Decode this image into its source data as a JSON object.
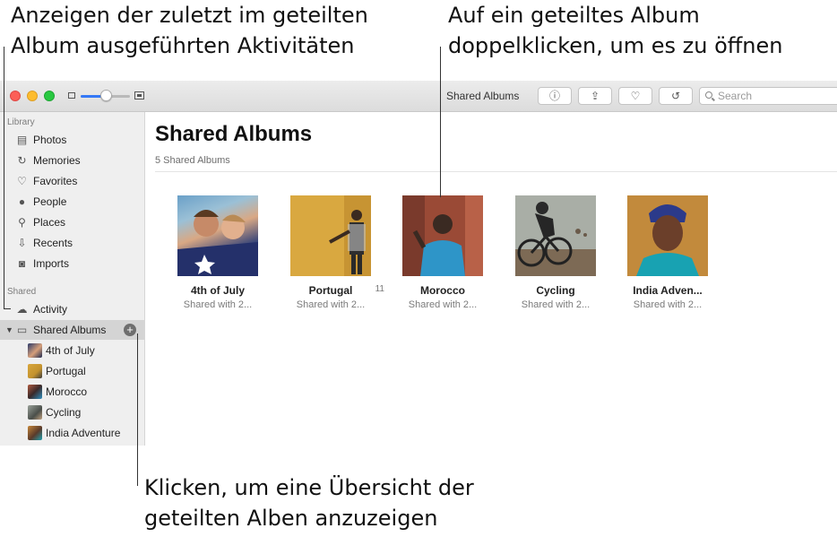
{
  "callouts": {
    "activity_line1": "Anzeigen der zuletzt im geteilten",
    "activity_line2": "Album ausgeführten Aktivitäten",
    "open_line1": "Auf ein geteiltes Album",
    "open_line2": "doppelklicken, um es zu öffnen",
    "overview_line1": "Klicken, um eine Übersicht der",
    "overview_line2": "geteilten Alben anzuzeigen"
  },
  "window": {
    "title": "Shared Albums",
    "search_placeholder": "Search",
    "zoom_fraction": 0.45
  },
  "toolbar": {
    "info_icon": "ⓘ",
    "share_icon": "⇪",
    "favorite_icon": "♡",
    "rotate_icon": "↺"
  },
  "sidebar": {
    "library_heading": "Library",
    "library_items": [
      {
        "label": "Photos",
        "icon": "photos-icon"
      },
      {
        "label": "Memories",
        "icon": "memories-icon"
      },
      {
        "label": "Favorites",
        "icon": "heart-icon"
      },
      {
        "label": "People",
        "icon": "person-icon"
      },
      {
        "label": "Places",
        "icon": "pin-icon"
      },
      {
        "label": "Recents",
        "icon": "recents-icon"
      },
      {
        "label": "Imports",
        "icon": "camera-icon"
      }
    ],
    "shared_heading": "Shared",
    "activity_label": "Activity",
    "shared_albums_label": "Shared Albums",
    "shared_albums": [
      {
        "label": "4th of July"
      },
      {
        "label": "Portugal"
      },
      {
        "label": "Morocco"
      },
      {
        "label": "Cycling"
      },
      {
        "label": "India Adventure"
      }
    ]
  },
  "main": {
    "title": "Shared Albums",
    "subtitle": "5 Shared Albums",
    "albums": [
      {
        "name": "4th of July",
        "shared": "Shared with 2..."
      },
      {
        "name": "Portugal",
        "shared": "Shared with 2...",
        "count": "11"
      },
      {
        "name": "Morocco",
        "shared": "Shared with 2..."
      },
      {
        "name": "Cycling",
        "shared": "Shared with 2..."
      },
      {
        "name": "India Adven...",
        "shared": "Shared with 2..."
      }
    ]
  },
  "colors": {
    "accent": "#3478f6",
    "sidebar_bg": "#efefef",
    "selection": "#d4d4d4"
  }
}
